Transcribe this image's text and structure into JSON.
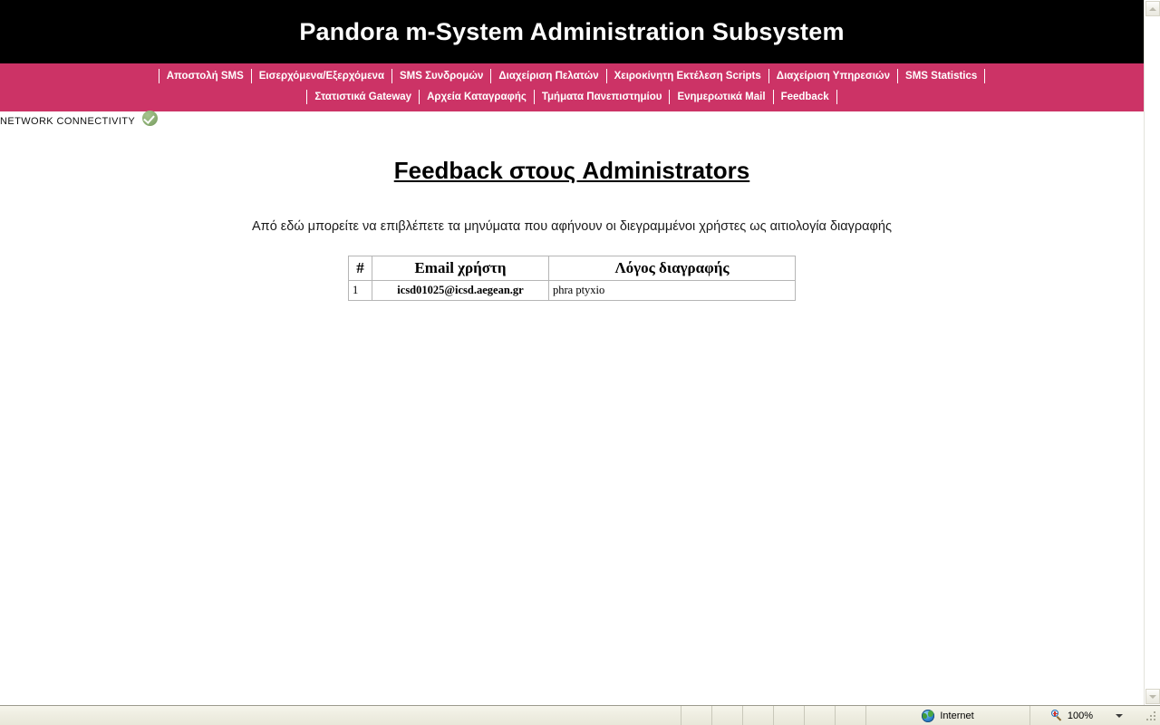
{
  "browser": {
    "status_bar": {
      "zone_label": "Internet",
      "zone_icon": "globe-icon",
      "zoom_label": "100%",
      "zoom_icon": "magnifier-plus-icon"
    },
    "scrollbar": {
      "up_icon": "chevron-up-icon",
      "down_icon": "chevron-down-icon"
    }
  },
  "header": {
    "title": "Pandora m-System Administration Subsystem"
  },
  "nav": {
    "row1": [
      {
        "label": "Αποστολή SMS"
      },
      {
        "label": "Εισερχόμενα/Εξερχόμενα"
      },
      {
        "label": "SMS Συνδρομών"
      },
      {
        "label": "Διαχείριση Πελατών"
      },
      {
        "label": "Χειροκίνητη Εκτέλεση Scripts"
      },
      {
        "label": "Διαχείριση Υπηρεσιών"
      },
      {
        "label": "SMS Statistics"
      }
    ],
    "row2": [
      {
        "label": "Στατιστικά Gateway"
      },
      {
        "label": "Αρχεία Καταγραφής"
      },
      {
        "label": "Τμήματα Πανεπιστημίου"
      },
      {
        "label": "Ενημερωτικά Mail"
      },
      {
        "label": "Feedback"
      }
    ]
  },
  "connectivity": {
    "label": "NETWORK CONNECTIVITY",
    "status_icon": "check-circle-icon"
  },
  "main": {
    "title": "Feedback στους Administrators",
    "subtitle": "Από εδώ μπορείτε να επιβλέπετε τα μηνύματα που αφήνουν οι διεγραμμένοι χρήστες ως αιτιολογία διαγραφής",
    "table": {
      "columns": [
        "#",
        "Email χρήστη",
        "Λόγος διαγραφής"
      ],
      "rows": [
        {
          "index": "1",
          "email": "icsd01025@icsd.aegean.gr",
          "reason": "phra ptyxio"
        }
      ]
    }
  },
  "colors": {
    "nav_pink": "#cc3366",
    "header_black": "#000000",
    "status_ok_green": "#8aad72"
  }
}
